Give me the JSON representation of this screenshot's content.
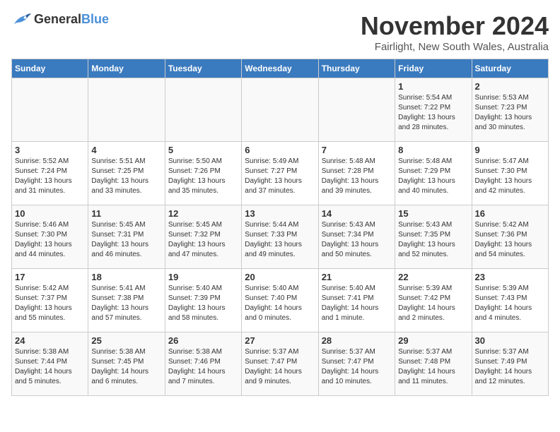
{
  "header": {
    "logo_general": "General",
    "logo_blue": "Blue",
    "month": "November 2024",
    "location": "Fairlight, New South Wales, Australia"
  },
  "weekdays": [
    "Sunday",
    "Monday",
    "Tuesday",
    "Wednesday",
    "Thursday",
    "Friday",
    "Saturday"
  ],
  "weeks": [
    [
      {
        "day": "",
        "info": ""
      },
      {
        "day": "",
        "info": ""
      },
      {
        "day": "",
        "info": ""
      },
      {
        "day": "",
        "info": ""
      },
      {
        "day": "",
        "info": ""
      },
      {
        "day": "1",
        "info": "Sunrise: 5:54 AM\nSunset: 7:22 PM\nDaylight: 13 hours and 28 minutes."
      },
      {
        "day": "2",
        "info": "Sunrise: 5:53 AM\nSunset: 7:23 PM\nDaylight: 13 hours and 30 minutes."
      }
    ],
    [
      {
        "day": "3",
        "info": "Sunrise: 5:52 AM\nSunset: 7:24 PM\nDaylight: 13 hours and 31 minutes."
      },
      {
        "day": "4",
        "info": "Sunrise: 5:51 AM\nSunset: 7:25 PM\nDaylight: 13 hours and 33 minutes."
      },
      {
        "day": "5",
        "info": "Sunrise: 5:50 AM\nSunset: 7:26 PM\nDaylight: 13 hours and 35 minutes."
      },
      {
        "day": "6",
        "info": "Sunrise: 5:49 AM\nSunset: 7:27 PM\nDaylight: 13 hours and 37 minutes."
      },
      {
        "day": "7",
        "info": "Sunrise: 5:48 AM\nSunset: 7:28 PM\nDaylight: 13 hours and 39 minutes."
      },
      {
        "day": "8",
        "info": "Sunrise: 5:48 AM\nSunset: 7:29 PM\nDaylight: 13 hours and 40 minutes."
      },
      {
        "day": "9",
        "info": "Sunrise: 5:47 AM\nSunset: 7:30 PM\nDaylight: 13 hours and 42 minutes."
      }
    ],
    [
      {
        "day": "10",
        "info": "Sunrise: 5:46 AM\nSunset: 7:30 PM\nDaylight: 13 hours and 44 minutes."
      },
      {
        "day": "11",
        "info": "Sunrise: 5:45 AM\nSunset: 7:31 PM\nDaylight: 13 hours and 46 minutes."
      },
      {
        "day": "12",
        "info": "Sunrise: 5:45 AM\nSunset: 7:32 PM\nDaylight: 13 hours and 47 minutes."
      },
      {
        "day": "13",
        "info": "Sunrise: 5:44 AM\nSunset: 7:33 PM\nDaylight: 13 hours and 49 minutes."
      },
      {
        "day": "14",
        "info": "Sunrise: 5:43 AM\nSunset: 7:34 PM\nDaylight: 13 hours and 50 minutes."
      },
      {
        "day": "15",
        "info": "Sunrise: 5:43 AM\nSunset: 7:35 PM\nDaylight: 13 hours and 52 minutes."
      },
      {
        "day": "16",
        "info": "Sunrise: 5:42 AM\nSunset: 7:36 PM\nDaylight: 13 hours and 54 minutes."
      }
    ],
    [
      {
        "day": "17",
        "info": "Sunrise: 5:42 AM\nSunset: 7:37 PM\nDaylight: 13 hours and 55 minutes."
      },
      {
        "day": "18",
        "info": "Sunrise: 5:41 AM\nSunset: 7:38 PM\nDaylight: 13 hours and 57 minutes."
      },
      {
        "day": "19",
        "info": "Sunrise: 5:40 AM\nSunset: 7:39 PM\nDaylight: 13 hours and 58 minutes."
      },
      {
        "day": "20",
        "info": "Sunrise: 5:40 AM\nSunset: 7:40 PM\nDaylight: 14 hours and 0 minutes."
      },
      {
        "day": "21",
        "info": "Sunrise: 5:40 AM\nSunset: 7:41 PM\nDaylight: 14 hours and 1 minute."
      },
      {
        "day": "22",
        "info": "Sunrise: 5:39 AM\nSunset: 7:42 PM\nDaylight: 14 hours and 2 minutes."
      },
      {
        "day": "23",
        "info": "Sunrise: 5:39 AM\nSunset: 7:43 PM\nDaylight: 14 hours and 4 minutes."
      }
    ],
    [
      {
        "day": "24",
        "info": "Sunrise: 5:38 AM\nSunset: 7:44 PM\nDaylight: 14 hours and 5 minutes."
      },
      {
        "day": "25",
        "info": "Sunrise: 5:38 AM\nSunset: 7:45 PM\nDaylight: 14 hours and 6 minutes."
      },
      {
        "day": "26",
        "info": "Sunrise: 5:38 AM\nSunset: 7:46 PM\nDaylight: 14 hours and 7 minutes."
      },
      {
        "day": "27",
        "info": "Sunrise: 5:37 AM\nSunset: 7:47 PM\nDaylight: 14 hours and 9 minutes."
      },
      {
        "day": "28",
        "info": "Sunrise: 5:37 AM\nSunset: 7:47 PM\nDaylight: 14 hours and 10 minutes."
      },
      {
        "day": "29",
        "info": "Sunrise: 5:37 AM\nSunset: 7:48 PM\nDaylight: 14 hours and 11 minutes."
      },
      {
        "day": "30",
        "info": "Sunrise: 5:37 AM\nSunset: 7:49 PM\nDaylight: 14 hours and 12 minutes."
      }
    ]
  ]
}
